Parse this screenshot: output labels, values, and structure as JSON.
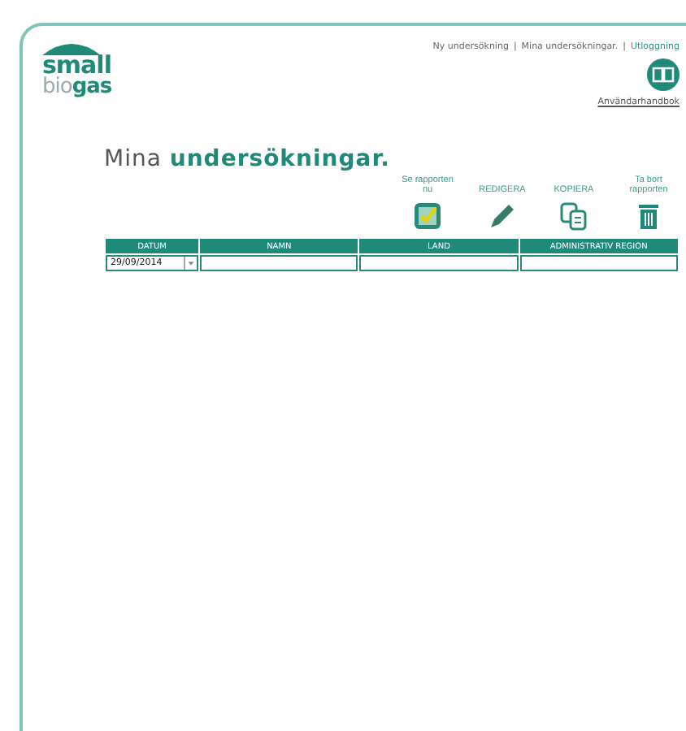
{
  "logo": {
    "line_1": "small",
    "line_2": "bio**gas**"
  },
  "nav": [
    {
      "kind": "link",
      "label": "Ny undersökning",
      "selected": false
    },
    {
      "kind": "separator",
      "label": "|"
    },
    {
      "kind": "link",
      "label": "Mina undersökningar.",
      "selected": false
    },
    {
      "kind": "separator",
      "label": "|"
    },
    {
      "kind": "link",
      "label": "Utloggning",
      "selected": true
    }
  ],
  "manual": {
    "label": "Användarhandbok"
  },
  "title": "Mina **undersökningar.**",
  "actions": [
    {
      "kind": "view",
      "label": "Se rapporten nu"
    },
    {
      "kind": "edit",
      "label": "REDIGERA"
    },
    {
      "kind": "copy",
      "label": "KOPIERA"
    },
    {
      "kind": "delete",
      "label": "Ta bort rapporten"
    }
  ],
  "table": {
    "columns": [
      "DATUM",
      "NAMN",
      "LAND",
      "ADMINISTRATIV REGION"
    ],
    "filters": [
      {
        "kind": "date",
        "value": "29/09/2014"
      },
      {
        "kind": "text"
      },
      {
        "kind": "text"
      },
      {
        "kind": "text"
      }
    ]
  }
}
